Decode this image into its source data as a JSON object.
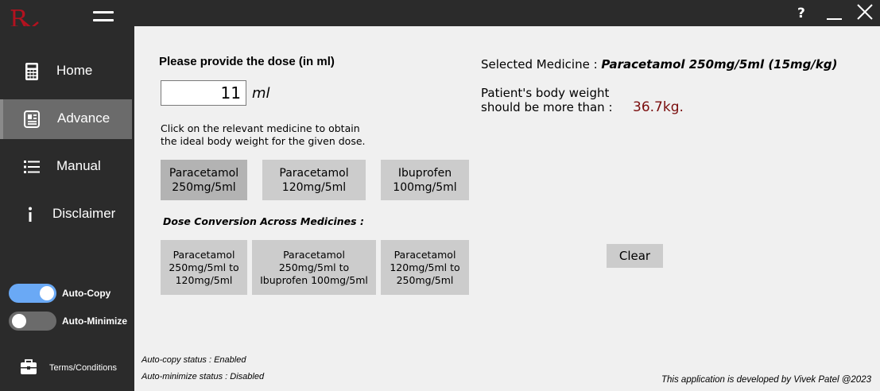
{
  "titlebar": {
    "help_label": "?",
    "accent_color": "#b3121f"
  },
  "sidebar": {
    "items": [
      {
        "label": "Home",
        "icon": "calculator-icon",
        "active": false
      },
      {
        "label": "Advance",
        "icon": "document-icon",
        "active": true
      },
      {
        "label": "Manual",
        "icon": "list-icon",
        "active": false
      },
      {
        "label": "Disclaimer",
        "icon": "info-icon",
        "active": false
      }
    ],
    "toggles": [
      {
        "label": "Auto-Copy",
        "on": true,
        "color": "#6aa9f5"
      },
      {
        "label": "Auto-Minimize",
        "on": false,
        "color": "#6b6b6b"
      }
    ],
    "terms_label": "Terms/Conditions"
  },
  "main": {
    "dose_label": "Please provide the dose (in ml)",
    "dose_value": "11",
    "dose_unit": "ml",
    "instruction_line1": "Click on the relevant medicine to obtain",
    "instruction_line2": "the ideal body weight for the given dose.",
    "medicines": [
      {
        "label": "Paracetamol\n250mg/5ml",
        "selected": true
      },
      {
        "label": "Paracetamol\n120mg/5ml",
        "selected": false
      },
      {
        "label": "Ibuprofen\n100mg/5ml",
        "selected": false
      }
    ],
    "conversion_heading": "Dose Conversion Across Medicines :",
    "conversions": [
      {
        "label": "Paracetamol\n250mg/5ml to\n120mg/5ml"
      },
      {
        "label": "Paracetamol\n250mg/5ml to\nIbuprofen 100mg/5ml"
      },
      {
        "label": "Paracetamol\n120mg/5ml to\n250mg/5ml"
      }
    ],
    "selected_prefix": "Selected Medicine : ",
    "selected_medicine": "Paracetamol 250mg/5ml (15mg/kg)",
    "weight_line1": "Patient's body weight",
    "weight_line2": "should be more than : ",
    "weight_value": "36.7kg.",
    "clear_label": "Clear",
    "auto_copy_status": "Auto-copy status : Enabled",
    "auto_minimize_status": "Auto-minimize status : Disabled",
    "credit": "This application is developed by Vivek Patel @2023"
  }
}
